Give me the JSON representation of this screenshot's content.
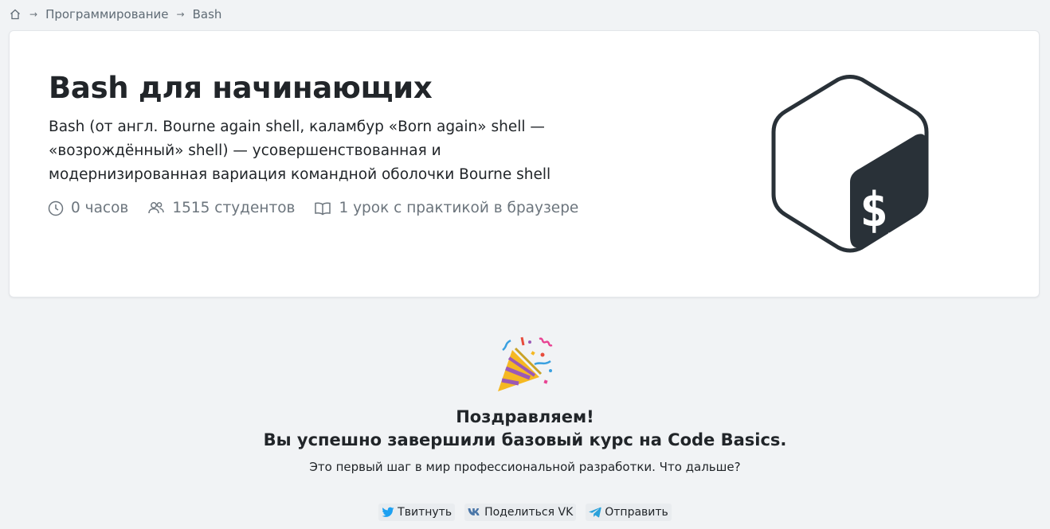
{
  "breadcrumb": {
    "home_icon": "home-icon",
    "items": [
      "Программирование",
      "Bash"
    ],
    "separator": "→"
  },
  "course": {
    "title": "Bash для начинающих",
    "description": "Bash (от англ. Bourne again shell, каламбур «Born again» shell — «возрождённый» shell) — усовершенствованная и модернизированная вариация командной оболочки Bourne shell",
    "meta": {
      "duration": "0 часов",
      "students": "1515 студентов",
      "lessons": "1 урок с практикой в браузере"
    },
    "logo_text": "$_",
    "logo_color": "#293138"
  },
  "congrats": {
    "icon": "party-popper-icon",
    "title_line1": "Поздравляем!",
    "title_line2": "Вы успешно завершили базовый курс на Code Basics.",
    "subtitle": "Это первый шаг в мир профессиональной разработки. Что дальше?"
  },
  "share": {
    "twitter": "Твитнуть",
    "vk": "Поделиться VK",
    "telegram": "Отправить"
  }
}
